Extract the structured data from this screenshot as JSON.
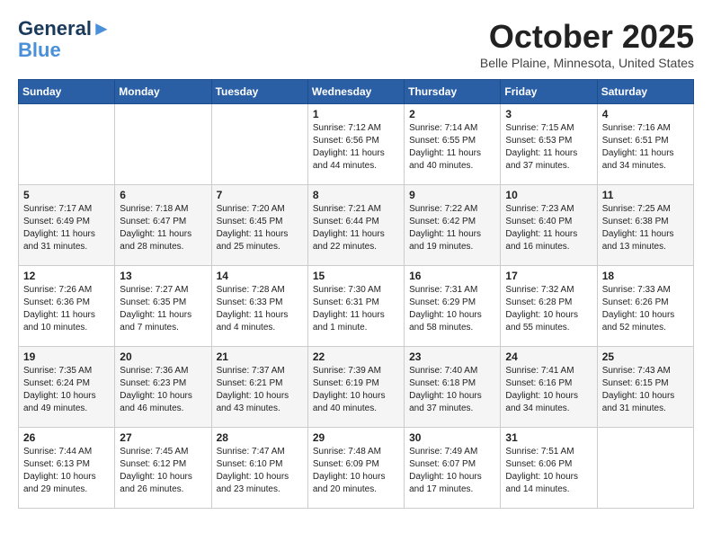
{
  "header": {
    "logo_line1": "General",
    "logo_line2": "Blue",
    "month_year": "October 2025",
    "location": "Belle Plaine, Minnesota, United States"
  },
  "days_of_week": [
    "Sunday",
    "Monday",
    "Tuesday",
    "Wednesday",
    "Thursday",
    "Friday",
    "Saturday"
  ],
  "weeks": [
    [
      {
        "day": "",
        "info": ""
      },
      {
        "day": "",
        "info": ""
      },
      {
        "day": "",
        "info": ""
      },
      {
        "day": "1",
        "info": "Sunrise: 7:12 AM\nSunset: 6:56 PM\nDaylight: 11 hours\nand 44 minutes."
      },
      {
        "day": "2",
        "info": "Sunrise: 7:14 AM\nSunset: 6:55 PM\nDaylight: 11 hours\nand 40 minutes."
      },
      {
        "day": "3",
        "info": "Sunrise: 7:15 AM\nSunset: 6:53 PM\nDaylight: 11 hours\nand 37 minutes."
      },
      {
        "day": "4",
        "info": "Sunrise: 7:16 AM\nSunset: 6:51 PM\nDaylight: 11 hours\nand 34 minutes."
      }
    ],
    [
      {
        "day": "5",
        "info": "Sunrise: 7:17 AM\nSunset: 6:49 PM\nDaylight: 11 hours\nand 31 minutes."
      },
      {
        "day": "6",
        "info": "Sunrise: 7:18 AM\nSunset: 6:47 PM\nDaylight: 11 hours\nand 28 minutes."
      },
      {
        "day": "7",
        "info": "Sunrise: 7:20 AM\nSunset: 6:45 PM\nDaylight: 11 hours\nand 25 minutes."
      },
      {
        "day": "8",
        "info": "Sunrise: 7:21 AM\nSunset: 6:44 PM\nDaylight: 11 hours\nand 22 minutes."
      },
      {
        "day": "9",
        "info": "Sunrise: 7:22 AM\nSunset: 6:42 PM\nDaylight: 11 hours\nand 19 minutes."
      },
      {
        "day": "10",
        "info": "Sunrise: 7:23 AM\nSunset: 6:40 PM\nDaylight: 11 hours\nand 16 minutes."
      },
      {
        "day": "11",
        "info": "Sunrise: 7:25 AM\nSunset: 6:38 PM\nDaylight: 11 hours\nand 13 minutes."
      }
    ],
    [
      {
        "day": "12",
        "info": "Sunrise: 7:26 AM\nSunset: 6:36 PM\nDaylight: 11 hours\nand 10 minutes."
      },
      {
        "day": "13",
        "info": "Sunrise: 7:27 AM\nSunset: 6:35 PM\nDaylight: 11 hours\nand 7 minutes."
      },
      {
        "day": "14",
        "info": "Sunrise: 7:28 AM\nSunset: 6:33 PM\nDaylight: 11 hours\nand 4 minutes."
      },
      {
        "day": "15",
        "info": "Sunrise: 7:30 AM\nSunset: 6:31 PM\nDaylight: 11 hours\nand 1 minute."
      },
      {
        "day": "16",
        "info": "Sunrise: 7:31 AM\nSunset: 6:29 PM\nDaylight: 10 hours\nand 58 minutes."
      },
      {
        "day": "17",
        "info": "Sunrise: 7:32 AM\nSunset: 6:28 PM\nDaylight: 10 hours\nand 55 minutes."
      },
      {
        "day": "18",
        "info": "Sunrise: 7:33 AM\nSunset: 6:26 PM\nDaylight: 10 hours\nand 52 minutes."
      }
    ],
    [
      {
        "day": "19",
        "info": "Sunrise: 7:35 AM\nSunset: 6:24 PM\nDaylight: 10 hours\nand 49 minutes."
      },
      {
        "day": "20",
        "info": "Sunrise: 7:36 AM\nSunset: 6:23 PM\nDaylight: 10 hours\nand 46 minutes."
      },
      {
        "day": "21",
        "info": "Sunrise: 7:37 AM\nSunset: 6:21 PM\nDaylight: 10 hours\nand 43 minutes."
      },
      {
        "day": "22",
        "info": "Sunrise: 7:39 AM\nSunset: 6:19 PM\nDaylight: 10 hours\nand 40 minutes."
      },
      {
        "day": "23",
        "info": "Sunrise: 7:40 AM\nSunset: 6:18 PM\nDaylight: 10 hours\nand 37 minutes."
      },
      {
        "day": "24",
        "info": "Sunrise: 7:41 AM\nSunset: 6:16 PM\nDaylight: 10 hours\nand 34 minutes."
      },
      {
        "day": "25",
        "info": "Sunrise: 7:43 AM\nSunset: 6:15 PM\nDaylight: 10 hours\nand 31 minutes."
      }
    ],
    [
      {
        "day": "26",
        "info": "Sunrise: 7:44 AM\nSunset: 6:13 PM\nDaylight: 10 hours\nand 29 minutes."
      },
      {
        "day": "27",
        "info": "Sunrise: 7:45 AM\nSunset: 6:12 PM\nDaylight: 10 hours\nand 26 minutes."
      },
      {
        "day": "28",
        "info": "Sunrise: 7:47 AM\nSunset: 6:10 PM\nDaylight: 10 hours\nand 23 minutes."
      },
      {
        "day": "29",
        "info": "Sunrise: 7:48 AM\nSunset: 6:09 PM\nDaylight: 10 hours\nand 20 minutes."
      },
      {
        "day": "30",
        "info": "Sunrise: 7:49 AM\nSunset: 6:07 PM\nDaylight: 10 hours\nand 17 minutes."
      },
      {
        "day": "31",
        "info": "Sunrise: 7:51 AM\nSunset: 6:06 PM\nDaylight: 10 hours\nand 14 minutes."
      },
      {
        "day": "",
        "info": ""
      }
    ]
  ]
}
